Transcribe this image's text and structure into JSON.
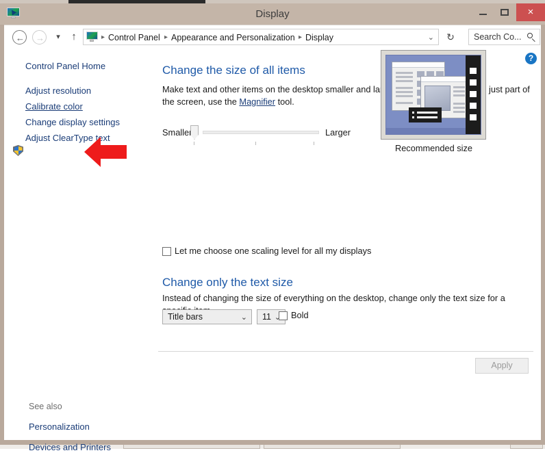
{
  "window": {
    "title": "Display",
    "icon": "display-monitor-icon",
    "minimize_label": "–",
    "maximize_label": "□",
    "close_label": "×"
  },
  "navbar": {
    "back_label": "←",
    "forward_label": "→",
    "recent_label": "▾",
    "up_label": "↑",
    "address_icon": "display-monitor-icon",
    "breadcrumbs": [
      "Control Panel",
      "Appearance and Personalization",
      "Display"
    ],
    "separator": "▸",
    "address_chevron": "⌄",
    "refresh_label": "↻",
    "search_value": "Search Co...",
    "search_icon": "search-icon"
  },
  "sidebar": {
    "home_label": "Control Panel Home",
    "items": [
      {
        "label": "Adjust resolution",
        "shield": false,
        "hovered": false
      },
      {
        "label": "Calibrate color",
        "shield": true,
        "hovered": true
      },
      {
        "label": "Change display settings",
        "shield": false,
        "hovered": false
      },
      {
        "label": "Adjust ClearType text",
        "shield": false,
        "hovered": false
      }
    ],
    "see_also_label": "See also",
    "see_also_items": [
      {
        "label": "Personalization"
      },
      {
        "label": "Devices and Printers"
      }
    ]
  },
  "annotation": {
    "type": "red-arrow-pointing-left",
    "target": "Calibrate color",
    "color": "#ee1b1b"
  },
  "content": {
    "help_label": "?",
    "size_heading": "Change the size of all items",
    "size_description_part1": "Make text and other items on the desktop smaller and larger. To temporarily enlarge just part of the screen, use the ",
    "size_description_link": "Magnifier",
    "size_description_part2": " tool.",
    "slider": {
      "min_label": "Smaller",
      "max_label": "Larger",
      "value": 0,
      "ticks": 3
    },
    "preview_caption": "Recommended size",
    "scaling_checkbox": {
      "label": "Let me choose one scaling level for all my displays",
      "checked": false
    },
    "text_heading": "Change only the text size",
    "text_description": "Instead of changing the size of everything on the desktop, change only the text size for a specific item.",
    "item_select": {
      "value": "Title bars",
      "chevron": "⌄"
    },
    "size_select": {
      "value": "11",
      "chevron": "⌄"
    },
    "bold_checkbox": {
      "label": "Bold",
      "checked": false
    },
    "apply_label": "Apply",
    "apply_enabled": false
  },
  "colors": {
    "heading": "#1f5aa8",
    "link": "#1a3c77",
    "frame": "#b9a99c",
    "titlebar": "#c4b5a8",
    "close_button": "#cc5050",
    "accent_arrow": "#ee1b1b"
  }
}
